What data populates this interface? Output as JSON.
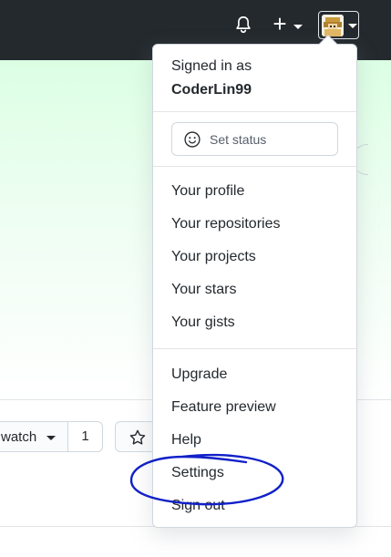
{
  "header": {
    "notifications_icon": "bell-icon",
    "create_icon": "plus-icon",
    "create_symbol": "+",
    "avatar_icon": "avatar"
  },
  "repo": {
    "watch_label": "watch",
    "watch_count": "1",
    "star_icon": "star-icon"
  },
  "user_menu": {
    "signed_in_label": "Signed in as",
    "username": "CoderLin99",
    "set_status_label": "Set status",
    "items": [
      "Your profile",
      "Your repositories",
      "Your projects",
      "Your stars",
      "Your gists",
      "Upgrade",
      "Feature preview",
      "Help",
      "Settings",
      "Sign out"
    ]
  },
  "colors": {
    "header_bg": "#24292e",
    "hero_tint": "#dcffe4",
    "annotation": "#1020c8"
  }
}
